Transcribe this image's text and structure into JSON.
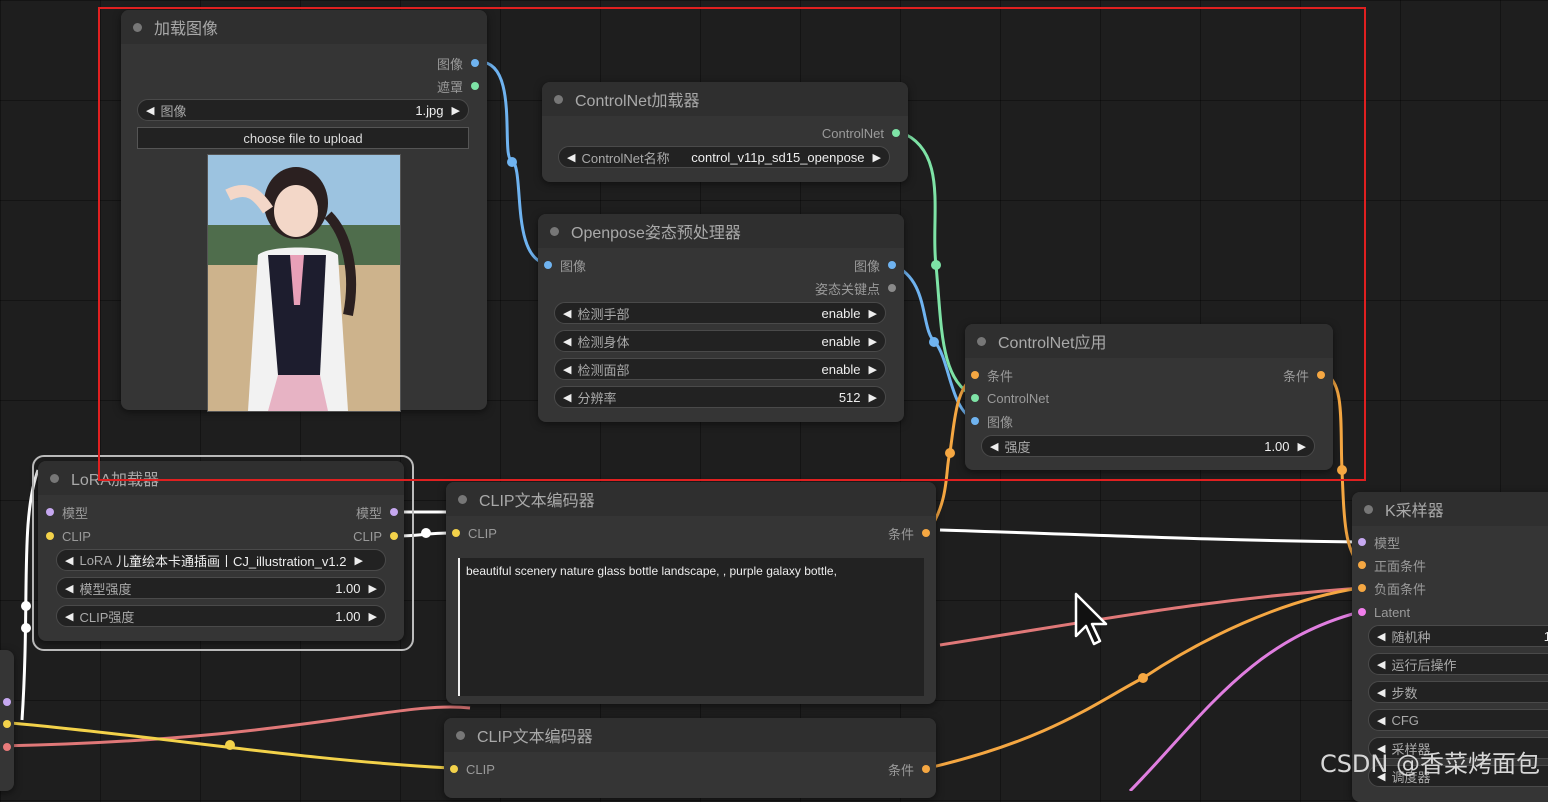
{
  "load_image": {
    "title": "加载图像",
    "out_image": "图像",
    "out_mask": "遮罩",
    "widget_label": "图像",
    "widget_value": "1.jpg",
    "upload_label": "choose file to upload"
  },
  "controlnet_loader": {
    "title": "ControlNet加载器",
    "out_label": "ControlNet",
    "widget_label": "ControlNet名称",
    "widget_value": "control_v11p_sd15_openpose"
  },
  "openpose": {
    "title": "Openpose姿态预处理器",
    "in_image": "图像",
    "out_image": "图像",
    "out_keypoints": "姿态关键点",
    "widgets": [
      {
        "label": "检测手部",
        "value": "enable"
      },
      {
        "label": "检测身体",
        "value": "enable"
      },
      {
        "label": "检测面部",
        "value": "enable"
      },
      {
        "label": "分辨率",
        "value": "512"
      }
    ]
  },
  "controlnet_apply": {
    "title": "ControlNet应用",
    "in_cond": "条件",
    "in_controlnet": "ControlNet",
    "in_image": "图像",
    "out_cond": "条件",
    "widget_label": "强度",
    "widget_value": "1.00"
  },
  "lora": {
    "title": "LoRA加载器",
    "in_model": "模型",
    "in_clip": "CLIP",
    "out_model": "模型",
    "out_clip": "CLIP",
    "widgets": [
      {
        "label": "LoRA",
        "value": "儿童绘本卡通插画丨CJ_illustration_v1.2"
      },
      {
        "label": "模型强度",
        "value": "1.00"
      },
      {
        "label": "CLIP强度",
        "value": "1.00"
      }
    ]
  },
  "clip1": {
    "title": "CLIP文本编码器",
    "in_clip": "CLIP",
    "out_cond": "条件",
    "text": "beautiful scenery nature glass bottle landscape, , purple galaxy bottle,"
  },
  "clip2": {
    "title": "CLIP文本编码器",
    "in_clip": "CLIP",
    "out_cond": "条件"
  },
  "ksampler": {
    "title": "K采样器",
    "in_model": "模型",
    "in_pos": "正面条件",
    "in_neg": "负面条件",
    "in_latent": "Latent",
    "widgets": [
      {
        "label": "随机种",
        "value": "1"
      },
      {
        "label": "运行后操作",
        "value": ""
      },
      {
        "label": "步数",
        "value": ""
      },
      {
        "label": "CFG",
        "value": ""
      },
      {
        "label": "采样器",
        "value": ""
      },
      {
        "label": "调度器",
        "value": ""
      }
    ]
  },
  "watermark": "CSDN @香菜烤面包",
  "colors": {
    "image_wire": "#6fb3f0",
    "controlnet_wire": "#7ee3a6",
    "conditioning_wire": "#f5a742",
    "clip_wire": "#f3d24a",
    "latent_wire": "#f07eeb",
    "model_wire": "#ffffff",
    "vae_wire": "#e87a7a",
    "highlight_box": "#e02020"
  }
}
